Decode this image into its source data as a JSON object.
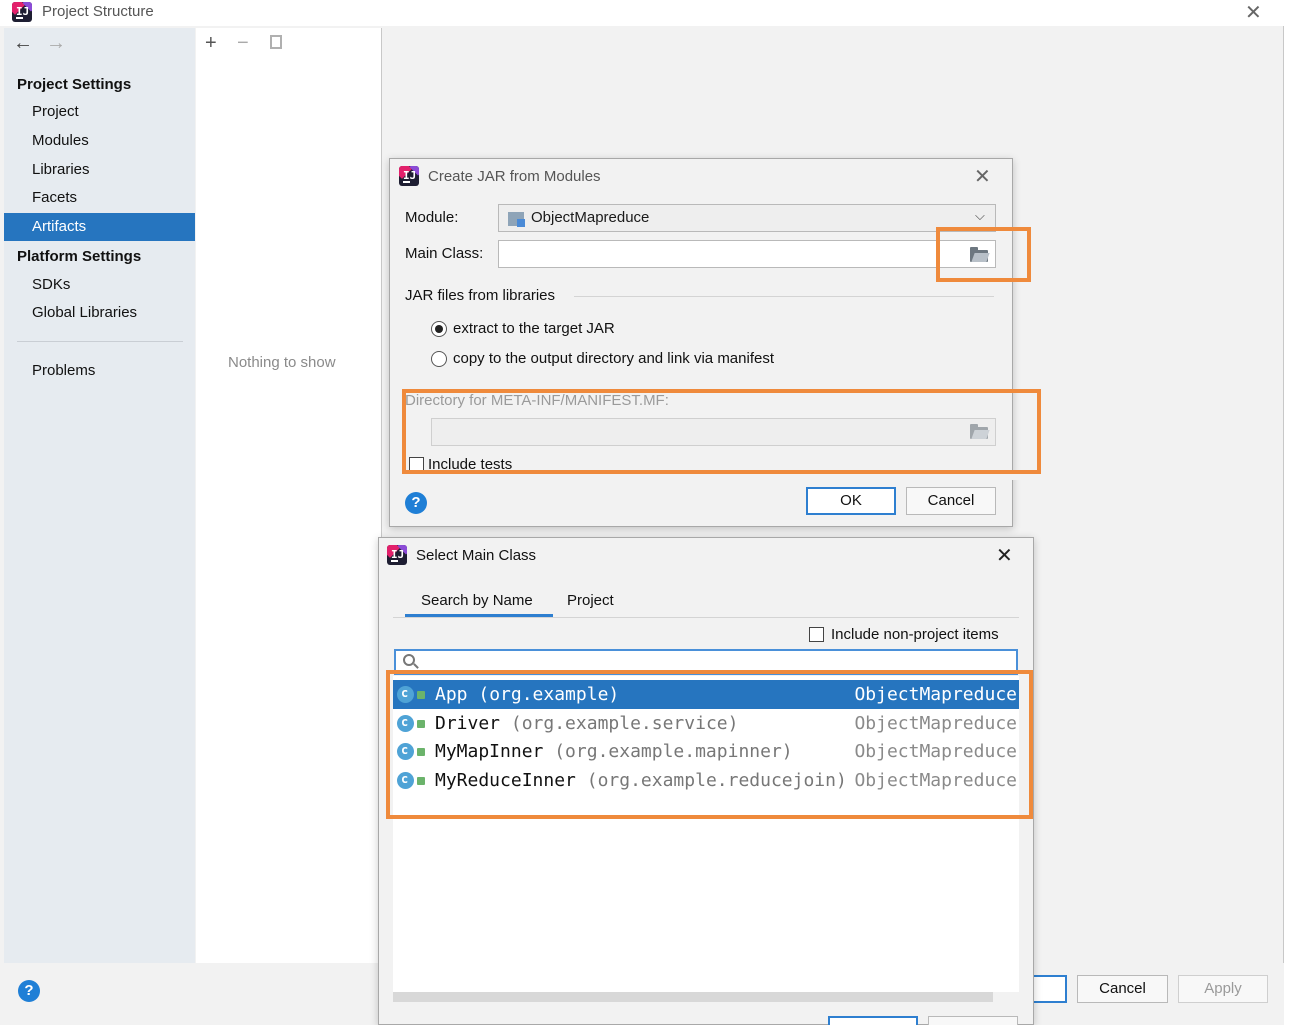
{
  "main_window": {
    "title": "Project Structure",
    "nav": {
      "back": "←",
      "forward": "→"
    },
    "project_settings_header": "Project Settings",
    "project_settings_items": [
      {
        "label": "Project"
      },
      {
        "label": "Modules"
      },
      {
        "label": "Libraries"
      },
      {
        "label": "Facets"
      },
      {
        "label": "Artifacts",
        "selected": true
      }
    ],
    "platform_settings_header": "Platform Settings",
    "platform_settings_items": [
      {
        "label": "SDKs"
      },
      {
        "label": "Global Libraries"
      }
    ],
    "problems_label": "Problems",
    "toolbar": {
      "add": "+",
      "remove": "−"
    },
    "empty_text": "Nothing to show",
    "buttons": {
      "cancel": "Cancel",
      "apply": "Apply"
    }
  },
  "jar_dialog": {
    "title": "Create JAR from Modules",
    "module_label": "Module:",
    "module_value": "ObjectMapreduce",
    "main_class_label": "Main Class:",
    "main_class_value": "",
    "jar_files_label": "JAR files from libraries",
    "option_extract": "extract to the target JAR",
    "option_copy": "copy to the output directory and link via manifest",
    "selected_option": "extract",
    "manifest_dir_label": "Directory for META-INF/MANIFEST.MF:",
    "manifest_dir_value": "",
    "include_tests_label": "Include tests",
    "include_tests_checked": false,
    "ok": "OK",
    "cancel": "Cancel",
    "help": "?"
  },
  "main_class_dialog": {
    "title": "Select Main Class",
    "tabs": [
      {
        "label": "Search by Name",
        "active": true
      },
      {
        "label": "Project",
        "active": false
      }
    ],
    "include_non_project_label": "Include non-project items",
    "include_non_project_checked": false,
    "search_value": "",
    "classes": [
      {
        "name": "App",
        "package": "(org.example)",
        "module": "ObjectMapreduce",
        "selected": true
      },
      {
        "name": "Driver",
        "package": "(org.example.service)",
        "module": "ObjectMapreduce",
        "selected": false
      },
      {
        "name": "MyMapInner",
        "package": "(org.example.mapinner)",
        "module": "ObjectMapreduce",
        "selected": false
      },
      {
        "name": "MyReduceInner",
        "package": "(org.example.reducejoin)",
        "module": "ObjectMapreduce",
        "selected": false
      }
    ]
  },
  "colors": {
    "selection": "#2675bf",
    "highlight_box": "#ef8a3c",
    "focus": "#2e7fd0"
  }
}
